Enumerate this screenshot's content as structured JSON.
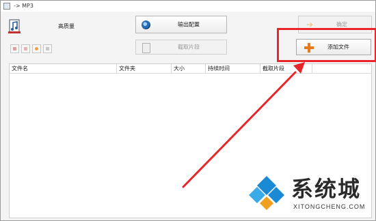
{
  "window": {
    "title": "-> MP3"
  },
  "toolbar": {
    "quality_label": "高质量",
    "output_config_label": "输出配置",
    "clip_label": "截取片段",
    "ok_label": "确定",
    "add_file_label": "添加文件"
  },
  "file_table": {
    "columns": [
      "文件名",
      "文件夹",
      "大小",
      "持续时间",
      "截取片段"
    ],
    "rows": []
  },
  "watermark": {
    "brand": "系统城",
    "site": "XITONGCHENG.COM"
  },
  "colors": {
    "highlight": "#e8262a",
    "add_icon": "#e8791a",
    "watermark_blue": "#1a8ad4"
  }
}
